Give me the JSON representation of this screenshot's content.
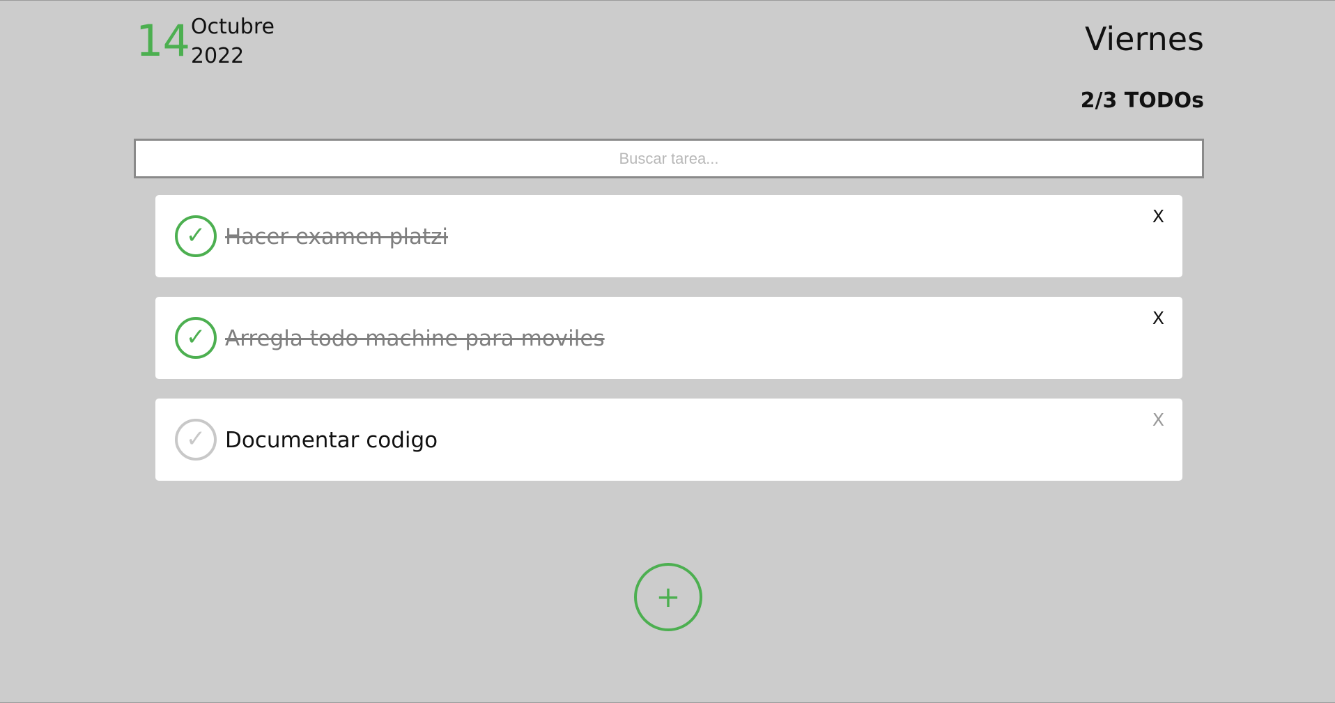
{
  "header": {
    "day": "14",
    "month": "Octubre",
    "year": "2022",
    "weekday": "Viernes",
    "counter": "2/3 TODOs"
  },
  "search": {
    "placeholder": "Buscar tarea...",
    "value": ""
  },
  "todos": [
    {
      "text": "Hacer examen platzi",
      "completed": true,
      "check_icon": "✓",
      "delete_label": "X"
    },
    {
      "text": "Arregla todo machine para moviles",
      "completed": true,
      "check_icon": "✓",
      "delete_label": "X"
    },
    {
      "text": "Documentar codigo",
      "completed": false,
      "check_icon": "✓",
      "delete_label": "X"
    }
  ],
  "add_button": {
    "label": "+"
  },
  "colors": {
    "accent": "#4caf50",
    "background": "#cccccc",
    "card": "#ffffff",
    "completed_text": "#7f7f7f",
    "unchecked": "#c8c8c8"
  }
}
